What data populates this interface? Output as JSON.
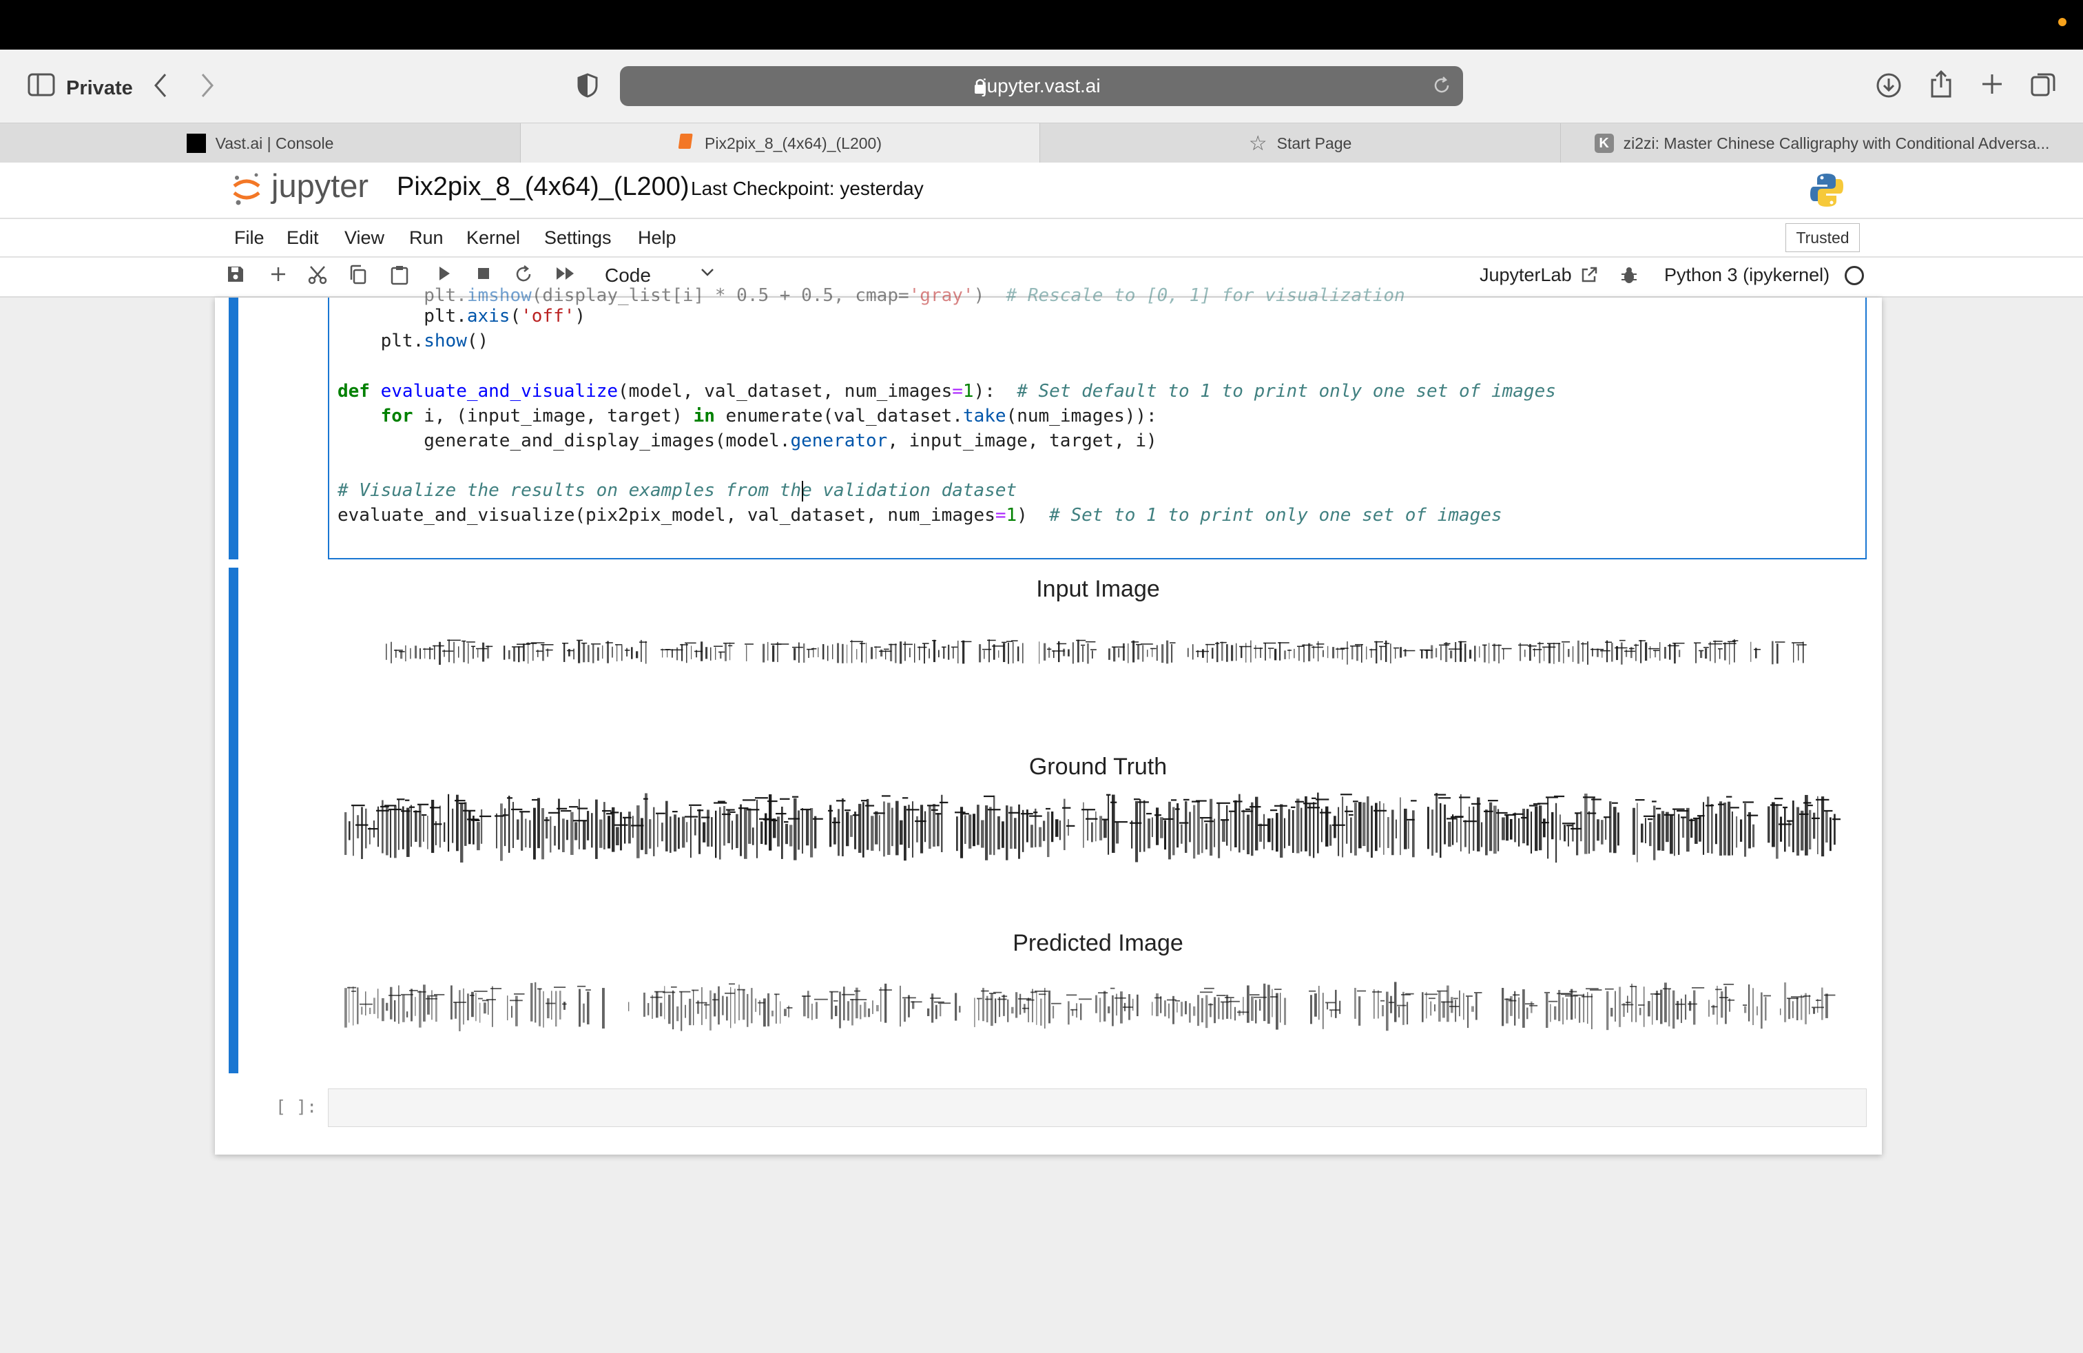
{
  "browser": {
    "private_label": "Private",
    "address": "jupyter.vast.ai",
    "tabs": [
      {
        "label": "Vast.ai | Console"
      },
      {
        "label": "Pix2pix_8_(4x64)_(L200)"
      },
      {
        "label": "Start Page"
      },
      {
        "label": "zi2zi: Master Chinese Calligraphy with Conditional Adversa..."
      }
    ]
  },
  "jupyter": {
    "logo_text": "jupyter",
    "notebook_title": "Pix2pix_8_(4x64)_(L200)",
    "checkpoint": "Last Checkpoint: yesterday",
    "menu": [
      "File",
      "Edit",
      "View",
      "Run",
      "Kernel",
      "Settings",
      "Help"
    ],
    "trusted": "Trusted",
    "cell_type": "Code",
    "jupyterlab_link": "JupyterLab",
    "kernel": "Python 3 (ipykernel)"
  },
  "code": {
    "line0": "        plt.imshow(display_list[i] * 0.5 + 0.5, cmap='gray')  # Rescale to [0, 1] for visualization",
    "line1": "        plt.axis('off')",
    "line2": "    plt.show()",
    "line3": "def evaluate_and_visualize(model, val_dataset, num_images=1):  # Set default to 1 to print only one set of images",
    "line4": "    for i, (input_image, target) in enumerate(val_dataset.take(num_images)):",
    "line5": "        generate_and_display_images(model.generator, input_image, target, i)",
    "line6": "# Visualize the results on examples from the validation dataset",
    "line7": "evaluate_and_visualize(pix2pix_model, val_dataset, num_images=1)  # Set to 1 to print only one set of images"
  },
  "output": {
    "titles": [
      "Input Image",
      "Ground Truth",
      "Predicted Image"
    ]
  },
  "empty_cell_prompt": "[ ]:",
  "colors": {
    "accent": "#1976d2",
    "jupyter_orange": "#f37726"
  }
}
